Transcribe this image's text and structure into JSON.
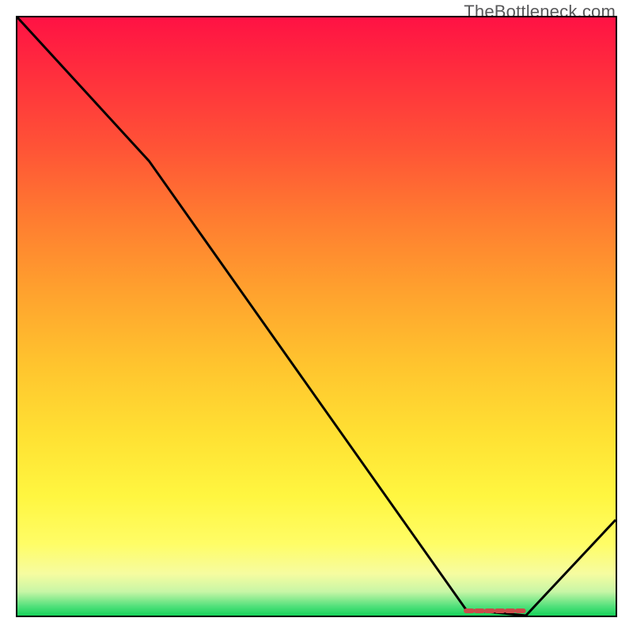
{
  "watermark": "TheBottleneck.com",
  "chart_data": {
    "type": "line",
    "title": "",
    "xlabel": "",
    "ylabel": "",
    "xlim": [
      0,
      100
    ],
    "ylim": [
      0,
      100
    ],
    "curve": [
      {
        "x": 0,
        "y": 100
      },
      {
        "x": 22,
        "y": 76
      },
      {
        "x": 75,
        "y": 1
      },
      {
        "x": 85,
        "y": 0
      },
      {
        "x": 100,
        "y": 16
      }
    ],
    "minimum_marker": {
      "x_start": 75,
      "x_end": 85,
      "y": 0
    },
    "gradient_stops": [
      {
        "pos": 0,
        "color": "#ff1244"
      },
      {
        "pos": 8,
        "color": "#ff2a3e"
      },
      {
        "pos": 22,
        "color": "#ff5436"
      },
      {
        "pos": 34,
        "color": "#ff7d30"
      },
      {
        "pos": 46,
        "color": "#ffa22e"
      },
      {
        "pos": 58,
        "color": "#ffc42e"
      },
      {
        "pos": 70,
        "color": "#ffe133"
      },
      {
        "pos": 80,
        "color": "#fff640"
      },
      {
        "pos": 88,
        "color": "#fffd66"
      },
      {
        "pos": 93,
        "color": "#f6fca0"
      },
      {
        "pos": 96,
        "color": "#c8f6a6"
      },
      {
        "pos": 98.5,
        "color": "#4fe07a"
      },
      {
        "pos": 100,
        "color": "#17d25a"
      }
    ]
  }
}
